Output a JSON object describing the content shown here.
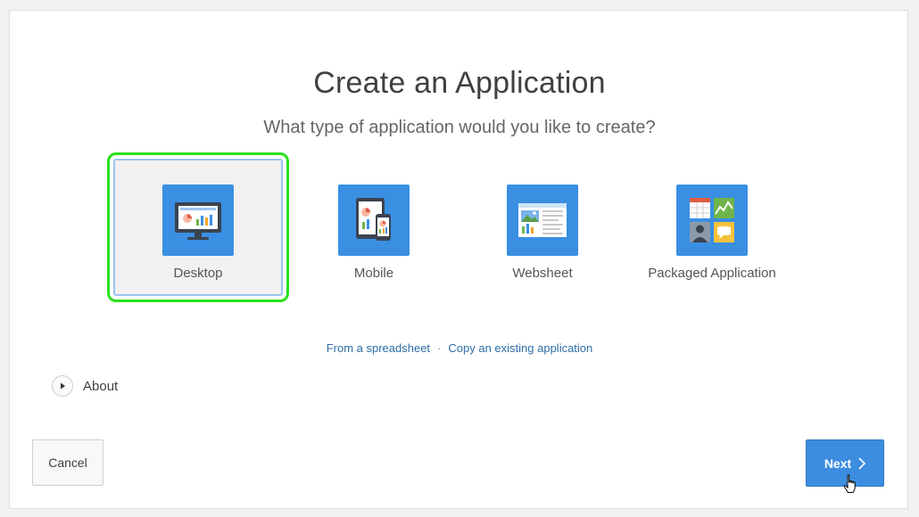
{
  "dialog": {
    "title": "Create an Application",
    "subtitle": "What type of application would you like to create?"
  },
  "options": [
    {
      "label": "Desktop",
      "icon": "desktop-icon",
      "selected": true
    },
    {
      "label": "Mobile",
      "icon": "mobile-icon",
      "selected": false
    },
    {
      "label": "Websheet",
      "icon": "websheet-icon",
      "selected": false
    },
    {
      "label": "Packaged Application",
      "icon": "packaged-application-icon",
      "selected": false
    }
  ],
  "links": {
    "spreadsheet": "From a spreadsheet",
    "separator": "·",
    "copy": "Copy an existing application"
  },
  "about": {
    "label": "About",
    "icon": "play-right-icon"
  },
  "buttons": {
    "cancel": "Cancel",
    "next": "Next",
    "next_icon": "chevron-right-icon"
  },
  "colors": {
    "accent": "#3a8fe3",
    "selection_outline": "#29e11c",
    "link": "#2e6ea8"
  }
}
